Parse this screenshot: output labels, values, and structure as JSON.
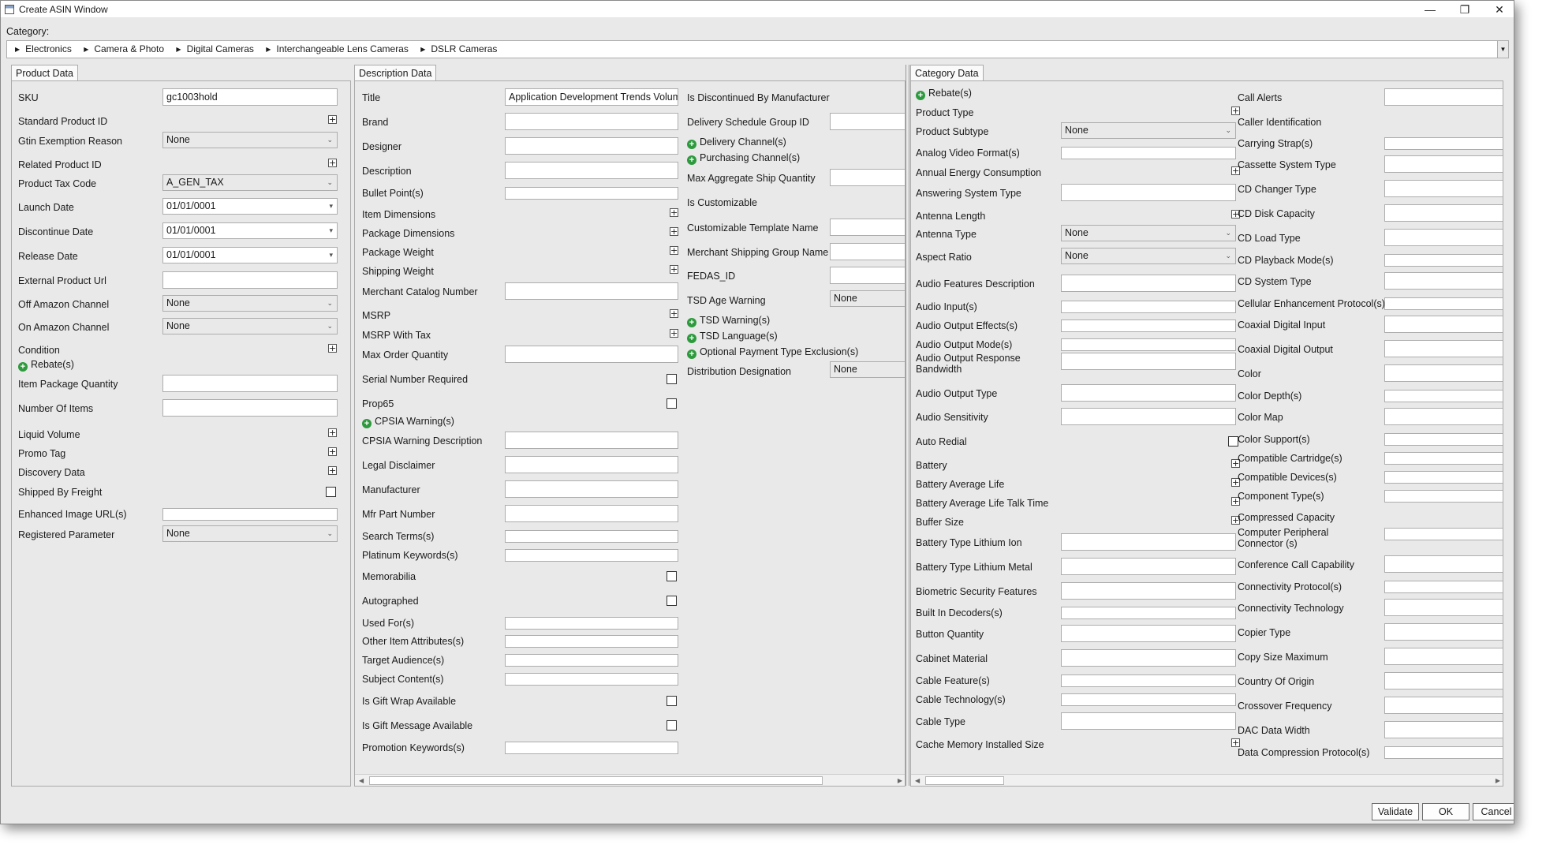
{
  "window": {
    "title": "Create ASIN Window"
  },
  "category": {
    "label": "Category:",
    "breadcrumbs": [
      "Electronics",
      "Camera & Photo",
      "Digital Cameras",
      "Interchangeable Lens Cameras",
      "DSLR Cameras"
    ]
  },
  "tabs": {
    "product": "Product Data",
    "description": "Description Data",
    "category": "Category Data"
  },
  "product": {
    "sku_label": "SKU",
    "sku_value": "gc1003hold",
    "std_product_id_label": "Standard Product ID",
    "gtin_label": "Gtin Exemption Reason",
    "gtin_value": "None",
    "related_label": "Related Product ID",
    "tax_label": "Product Tax Code",
    "tax_value": "A_GEN_TAX",
    "launch_label": "Launch Date",
    "launch_value": "01/01/0001",
    "discontinue_label": "Discontinue Date",
    "discontinue_value": "01/01/0001",
    "release_label": "Release Date",
    "release_value": "01/01/0001",
    "ext_url_label": "External Product Url",
    "off_amazon_label": "Off Amazon Channel",
    "off_amazon_value": "None",
    "on_amazon_label": "On Amazon Channel",
    "on_amazon_value": "None",
    "condition_label": "Condition",
    "rebates_label": "Rebate(s)",
    "item_pkg_qty_label": "Item Package Quantity",
    "num_items_label": "Number Of Items",
    "liquid_label": "Liquid Volume",
    "promo_label": "Promo Tag",
    "discovery_label": "Discovery Data",
    "freight_label": "Shipped By Freight",
    "enhanced_img_label": "Enhanced Image URL(s)",
    "registered_label": "Registered Parameter",
    "registered_value": "None"
  },
  "description": {
    "title_label": "Title",
    "title_value": "Application Development Trends Volum",
    "brand_label": "Brand",
    "designer_label": "Designer",
    "description_label": "Description",
    "bullet_label": "Bullet Point(s)",
    "item_dim_label": "Item Dimensions",
    "pkg_dim_label": "Package Dimensions",
    "pkg_weight_label": "Package Weight",
    "ship_weight_label": "Shipping Weight",
    "catalog_label": "Merchant Catalog Number",
    "msrp_label": "MSRP",
    "msrp_tax_label": "MSRP With Tax",
    "max_order_label": "Max Order Quantity",
    "serial_label": "Serial Number Required",
    "prop65_label": "Prop65",
    "cpsia_label": "CPSIA Warning(s)",
    "cpsia_desc_label": "CPSIA Warning Description",
    "legal_label": "Legal Disclaimer",
    "manufacturer_label": "Manufacturer",
    "mfr_part_label": "Mfr Part Number",
    "search_terms_label": "Search Terms(s)",
    "platinum_label": "Platinum Keywords(s)",
    "memorabilia_label": "Memorabilia",
    "autographed_label": "Autographed",
    "used_for_label": "Used For(s)",
    "other_attr_label": "Other Item Attributes(s)",
    "target_label": "Target Audience(s)",
    "subject_label": "Subject Content(s)",
    "gift_wrap_label": "Is Gift Wrap Available",
    "gift_msg_label": "Is Gift Message Available",
    "promo_kw_label": "Promotion Keywords(s)",
    "discontinued_label": "Is Discontinued By Manufacturer",
    "delivery_sched_label": "Delivery Schedule Group ID",
    "delivery_ch_label": "Delivery Channel(s)",
    "purchasing_ch_label": "Purchasing Channel(s)",
    "max_agg_label": "Max Aggregate Ship Quantity",
    "customizable_label": "Is Customizable",
    "custom_tpl_label": "Customizable Template Name",
    "merch_ship_label": "Merchant Shipping Group Name",
    "fedas_label": "FEDAS_ID",
    "tsd_age_label": "TSD Age Warning",
    "tsd_age_value": "None",
    "tsd_warn_label": "TSD Warning(s)",
    "tsd_lang_label": "TSD Language(s)",
    "opt_pay_label": "Optional Payment Type Exclusion(s)",
    "dist_label": "Distribution Designation",
    "dist_value": "None"
  },
  "categorydata": {
    "rebates": "Rebate(s)",
    "product_type": "Product Type",
    "product_subtype": "Product Subtype",
    "product_subtype_value": "None",
    "analog_video": "Analog Video Format(s)",
    "annual_energy": "Annual Energy Consumption",
    "answering": "Answering System Type",
    "antenna_length": "Antenna Length",
    "antenna_type": "Antenna Type",
    "antenna_type_value": "None",
    "aspect": "Aspect Ratio",
    "aspect_value": "None",
    "audio_features": "Audio Features Description",
    "audio_input": "Audio Input(s)",
    "audio_out_effects": "Audio Output Effects(s)",
    "audio_out_mode": "Audio Output Mode(s)",
    "audio_out_resp": "Audio Output Response Bandwidth",
    "audio_out_type": "Audio Output Type",
    "audio_sens": "Audio Sensitivity",
    "auto_redial": "Auto Redial",
    "battery": "Battery",
    "battery_avg_life": "Battery Average Life",
    "battery_avg_talk": "Battery Average Life Talk Time",
    "buffer": "Buffer Size",
    "bat_li_ion": "Battery Type Lithium Ion",
    "bat_li_metal": "Battery Type Lithium Metal",
    "biometric": "Biometric Security Features",
    "decoders": "Built In Decoders(s)",
    "button_qty": "Button Quantity",
    "cabinet": "Cabinet Material",
    "cable_feature": "Cable Feature(s)",
    "cable_tech": "Cable Technology(s)",
    "cable_type": "Cable Type",
    "cache_mem": "Cache Memory Installed Size",
    "call_alerts": "Call Alerts",
    "caller_id": "Caller Identification",
    "carrying": "Carrying Strap(s)",
    "cassette": "Cassette System Type",
    "cd_changer": "CD Changer Type",
    "cd_disk": "CD Disk Capacity",
    "cd_load": "CD Load Type",
    "cd_playback": "CD Playback Mode(s)",
    "cd_system": "CD System Type",
    "cellular": "Cellular Enhancement Protocol(s)",
    "coax_in": "Coaxial Digital Input",
    "coax_out": "Coaxial Digital Output",
    "color": "Color",
    "color_depth": "Color Depth(s)",
    "color_map": "Color Map",
    "color_support": "Color Support(s)",
    "compat_cart": "Compatible Cartridge(s)",
    "compat_dev": "Compatible Devices(s)",
    "component": "Component Type(s)",
    "compressed": "Compressed Capacity",
    "computer_periph": "Computer Peripheral Connector (s)",
    "conf_call": "Conference Call Capability",
    "conn_protocol": "Connectivity Protocol(s)",
    "conn_tech": "Connectivity Technology",
    "copier": "Copier Type",
    "copy_size": "Copy Size Maximum",
    "country": "Country Of Origin",
    "crossover": "Crossover Frequency",
    "dac": "DAC Data Width",
    "data_comp": "Data Compression Protocol(s)"
  },
  "buttons": {
    "validate": "Validate",
    "ok": "OK",
    "cancel": "Cancel"
  }
}
